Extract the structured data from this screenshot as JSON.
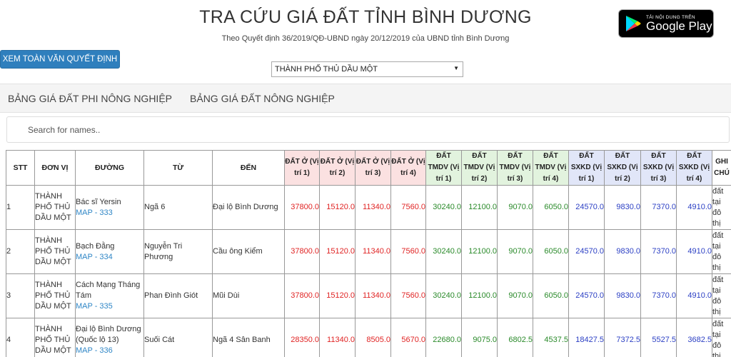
{
  "header": {
    "title": "TRA CỨU GIÁ ĐẤT TỈNH BÌNH DƯƠNG",
    "subtitle": "Theo Quyết định 36/2019/QĐ-UBND ngày 20/12/2019 của UBND tỉnh Bình Dương",
    "google_play": {
      "small": "TẢI NỘI DUNG TRÊN",
      "big": "Google Play"
    }
  },
  "decision_button": "XEM TOÀN VĂN QUYẾT ĐỊNH",
  "city_select": {
    "selected": "THÀNH PHỐ THỦ DẦU MỘT"
  },
  "nav": {
    "tab1": "BẢNG GIÁ ĐẤT PHI NÔNG NGHIỆP",
    "tab2": "BẢNG GIÁ ĐẤT NÔNG NGHIỆP"
  },
  "search": {
    "placeholder": "Search for names.."
  },
  "colors": {
    "pink": "#fbe1e1",
    "green": "#e2f3de",
    "blue": "#e1e6f8",
    "red_text": "#e02424",
    "green_text": "#2a8a2a",
    "blue_text": "#2b3fc4",
    "button": "#2f7fbd"
  },
  "table": {
    "headers": {
      "stt": "STT",
      "unit": "ĐƠN VỊ",
      "street": "ĐƯỜNG",
      "from": "TỪ",
      "to": "ĐẾN",
      "dato1": "ĐẤT Ở (Vị trí 1)",
      "dato2": "ĐẤT Ở (Vị trí 2)",
      "dato3": "ĐẤT Ở (Vị trí 3)",
      "dato4": "ĐẤT Ở (Vị trí 4)",
      "tmdv1": "ĐẤT TMDV (Vị trí 1)",
      "tmdv2": "ĐẤT TMDV (Vị trí 2)",
      "tmdv3": "ĐẤT TMDV (Vị trí 3)",
      "tmdv4": "ĐẤT TMDV (Vị trí 4)",
      "sxkd1": "ĐẤT SXKD (Vị trí 1)",
      "sxkd2": "ĐẤT SXKD (Vị trí 2)",
      "sxkd3": "ĐẤT SXKD (Vị trí 3)",
      "sxkd4": "ĐẤT SXKD (Vị trí 4)",
      "note": "GHI CHÚ"
    },
    "rows": [
      {
        "stt": "1",
        "unit": "THÀNH PHỐ THỦ DẦU MỘT",
        "street": "Bác sĩ Yersin",
        "map": "MAP - 333",
        "from": "Ngã 6",
        "to": "Đại lộ Bình Dương",
        "dato": [
          "37800.0",
          "15120.0",
          "11340.0",
          "7560.0"
        ],
        "tmdv": [
          "30240.0",
          "12100.0",
          "9070.0",
          "6050.0"
        ],
        "sxkd": [
          "24570.0",
          "9830.0",
          "7370.0",
          "4910.0"
        ],
        "note": "đất tại đô thị"
      },
      {
        "stt": "2",
        "unit": "THÀNH PHỐ THỦ DẦU MỘT",
        "street": "Bạch Đằng",
        "map": "MAP - 334",
        "from": "Nguyễn Tri Phương",
        "to": "Cầu ông Kiểm",
        "dato": [
          "37800.0",
          "15120.0",
          "11340.0",
          "7560.0"
        ],
        "tmdv": [
          "30240.0",
          "12100.0",
          "9070.0",
          "6050.0"
        ],
        "sxkd": [
          "24570.0",
          "9830.0",
          "7370.0",
          "4910.0"
        ],
        "note": "đất tại đô thị"
      },
      {
        "stt": "3",
        "unit": "THÀNH PHỐ THỦ DẦU MỘT",
        "street": "Cách Mạng Tháng Tám",
        "map": "MAP - 335",
        "from": "Phan Đình Giót",
        "to": "Mũi Dùi",
        "dato": [
          "37800.0",
          "15120.0",
          "11340.0",
          "7560.0"
        ],
        "tmdv": [
          "30240.0",
          "12100.0",
          "9070.0",
          "6050.0"
        ],
        "sxkd": [
          "24570.0",
          "9830.0",
          "7370.0",
          "4910.0"
        ],
        "note": "đất tại đô thị"
      },
      {
        "stt": "4",
        "unit": "THÀNH PHỐ THỦ DẦU MỘT",
        "street": "Đại lộ Bình Dương (Quốc lộ 13)",
        "map": "MAP - 336",
        "from": "Suối Cát",
        "to": "Ngã 4 Sân Banh",
        "dato": [
          "28350.0",
          "11340.0",
          "8505.0",
          "5670.0"
        ],
        "tmdv": [
          "22680.0",
          "9075.0",
          "6802.5",
          "4537.5"
        ],
        "sxkd": [
          "18427.5",
          "7372.5",
          "5527.5",
          "3682.5"
        ],
        "note": "đất tại đô thị"
      }
    ]
  }
}
